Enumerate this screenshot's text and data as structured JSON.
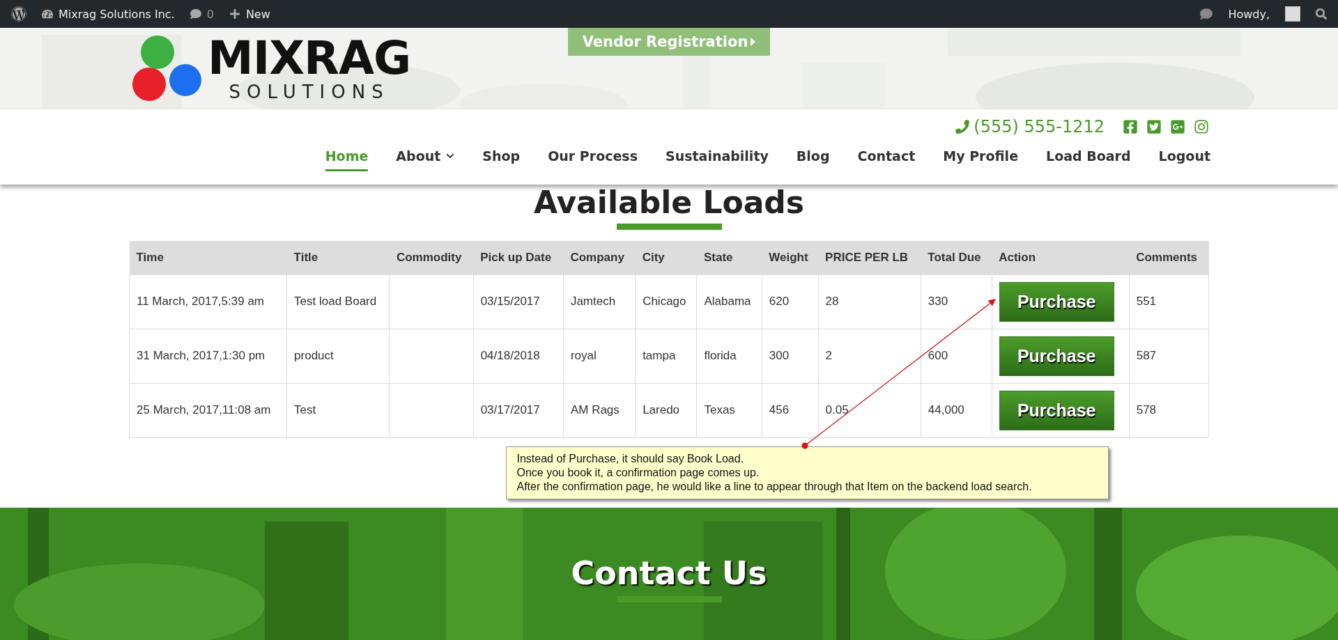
{
  "admin_bar": {
    "site_name": "Mixrag Solutions Inc.",
    "comments_count": "0",
    "new_label": "New",
    "greeting": "Howdy,"
  },
  "header": {
    "vendor_button": "Vendor Registration",
    "logo": {
      "name": "MIXRAG",
      "tagline": "SOLUTIONS"
    },
    "phone": "(555) 555-1212",
    "nav": [
      {
        "label": "Home",
        "selected": true,
        "has_menu": false
      },
      {
        "label": "About",
        "selected": false,
        "has_menu": true
      },
      {
        "label": "Shop",
        "selected": false,
        "has_menu": false
      },
      {
        "label": "Our Process",
        "selected": false,
        "has_menu": false
      },
      {
        "label": "Sustainability",
        "selected": false,
        "has_menu": false
      },
      {
        "label": "Blog",
        "selected": false,
        "has_menu": false
      },
      {
        "label": "Contact",
        "selected": false,
        "has_menu": false
      },
      {
        "label": "My Profile",
        "selected": false,
        "has_menu": false
      },
      {
        "label": "Load Board",
        "selected": false,
        "has_menu": false
      },
      {
        "label": "Logout",
        "selected": false,
        "has_menu": false
      }
    ]
  },
  "loads": {
    "heading": "Available Loads",
    "table": {
      "columns": [
        "Time",
        "Title",
        "Commodity",
        "Pick up Date",
        "Company",
        "City",
        "State",
        "Weight",
        "PRICE PER LB",
        "Total Due",
        "Action",
        "Comments"
      ],
      "rows": [
        {
          "time": "11 March, 2017,5:39 am",
          "title": "Test load Board",
          "pick_up_date": "03/15/2017",
          "company": "Jamtech",
          "city": "Chicago",
          "state": "Alabama",
          "weight": "620",
          "price_per_lb": "28",
          "total_due": "330",
          "action": "Purchase",
          "comments": "551"
        },
        {
          "time": "31 March, 2017,1:30 pm",
          "title": "product",
          "pick_up_date": "04/18/2018",
          "company": "royal",
          "city": "tampa",
          "state": "florida",
          "weight": "300",
          "price_per_lb": "2",
          "total_due": "600",
          "action": "Purchase",
          "comments": "587"
        },
        {
          "time": "25 March, 2017,11:08 am",
          "title": "Test",
          "pick_up_date": "03/17/2017",
          "company": "AM Rags",
          "city": "Laredo",
          "state": "Texas",
          "weight": "456",
          "price_per_lb": "0.05",
          "total_due": "44,000",
          "action": "Purchase",
          "comments": "578"
        }
      ]
    }
  },
  "annotation": {
    "lines": [
      "Instead of Purchase, it should say Book Load.",
      "Once you book it, a confirmation page comes up.",
      "After the confirmation page, he would like a line to appear through that Item on the backend load search."
    ]
  },
  "contact": {
    "heading": "Contact Us"
  }
}
